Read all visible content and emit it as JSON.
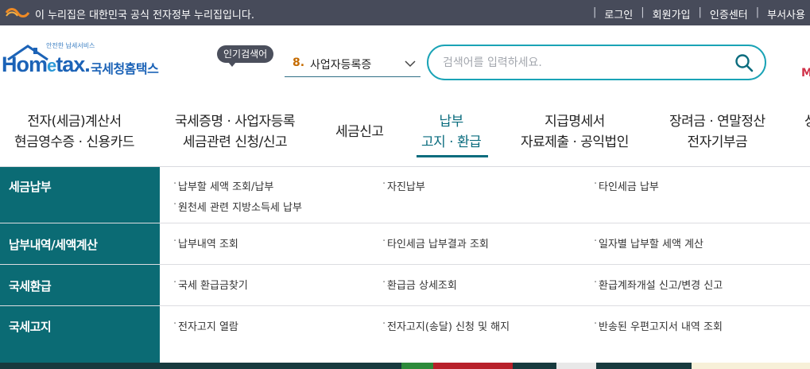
{
  "gov_bar": {
    "notice": "이 누리집은 대한민국 공식 전자정부 누리집입니다.",
    "links": [
      "로그인",
      "회원가입",
      "인증센터",
      "부서사용"
    ]
  },
  "logo": {
    "tagline": "안전한 납세서비스",
    "home": "Hom",
    "e": "e",
    "tax": "tax.",
    "korean": "국세청홈택스"
  },
  "popular": {
    "badge": "인기검색어",
    "rank": "8.",
    "term": "사업자등록증"
  },
  "search": {
    "placeholder": "검색어를 입력하세요."
  },
  "header_edge_text": "M",
  "gnb": [
    {
      "line1": "전자(세금)계산서",
      "line2": "현금영수증 · 신용카드"
    },
    {
      "line1": "국세증명 · 사업자등록",
      "line2": "세금관련 신청/신고"
    },
    {
      "line1": "세금신고",
      "line2": ""
    },
    {
      "line1": "납부",
      "line2": "고지 · 환급"
    },
    {
      "line1": "지급명세서",
      "line2": "자료제출 · 공익법인"
    },
    {
      "line1": "장려금 · 연말정산",
      "line2": "전자기부금"
    },
    {
      "line1": "상",
      "line2": ""
    }
  ],
  "mega_menu": [
    {
      "category": "세금납부",
      "links": [
        "납부할 세액 조회/납부",
        "자진납부",
        "타인세금 납부",
        "원천세 관련 지방소득세 납부"
      ]
    },
    {
      "category": "납부내역/세액계산",
      "links": [
        "납부내역 조회",
        "타인세금 납부결과 조회",
        "일자별 납부할 세액 계산"
      ]
    },
    {
      "category": "국세환급",
      "links": [
        "국세 환급금찾기",
        "환급금 상세조회",
        "환급계좌개설 신고/변경 신고"
      ]
    },
    {
      "category": "국세고지",
      "links": [
        "전자고지 열람",
        "전자고지(송달) 신청 및 해지",
        "반송된 우편고지서 내역 조회"
      ]
    }
  ],
  "colors": {
    "gov_bar": "#474b5a",
    "accent": "#0a6c7e",
    "category_bg": "#0b6b74",
    "search_border": "#1aa3b6"
  }
}
